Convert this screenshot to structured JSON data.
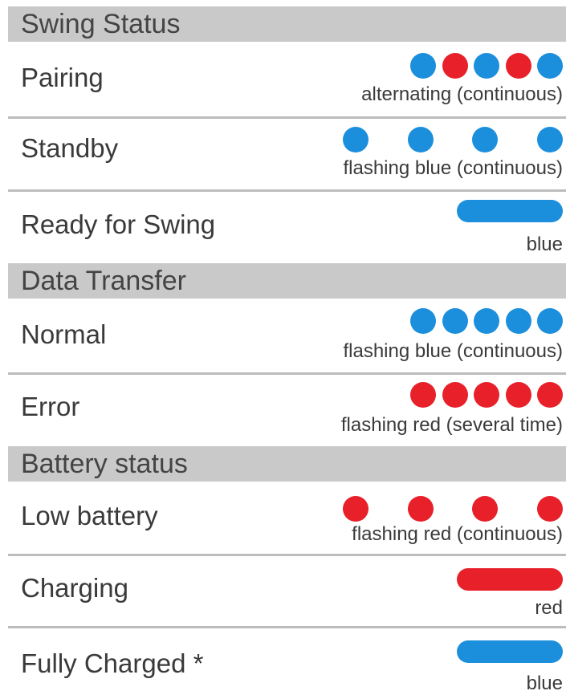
{
  "colors": {
    "blue": "#1c8fdc",
    "red": "#e8202a",
    "header_bg": "#c9c9c9",
    "divider": "#bdbdbd"
  },
  "sections": [
    {
      "title": "Swing Status",
      "rows": [
        {
          "label": "Pairing",
          "caption": "alternating (continuous)",
          "indicator": "dots",
          "pattern": [
            "blue",
            "red",
            "blue",
            "red",
            "blue"
          ],
          "spacing": "tight"
        },
        {
          "label": "Standby",
          "caption": "flashing blue (continuous)",
          "indicator": "dots",
          "pattern": [
            "blue",
            "blue",
            "blue",
            "blue"
          ],
          "spacing": "wide"
        },
        {
          "label": "Ready for Swing",
          "caption": "blue",
          "indicator": "bar",
          "pattern": [
            "blue"
          ]
        }
      ]
    },
    {
      "title": "Data Transfer",
      "rows": [
        {
          "label": "Normal",
          "caption": "flashing blue (continuous)",
          "indicator": "dots",
          "pattern": [
            "blue",
            "blue",
            "blue",
            "blue",
            "blue"
          ],
          "spacing": "tight"
        },
        {
          "label": "Error",
          "caption": "flashing red (several time)",
          "indicator": "dots",
          "pattern": [
            "red",
            "red",
            "red",
            "red",
            "red"
          ],
          "spacing": "tight"
        }
      ]
    },
    {
      "title": "Battery status",
      "rows": [
        {
          "label": "Low battery",
          "caption": "flashing red (continuous)",
          "indicator": "dots",
          "pattern": [
            "red",
            "red",
            "red",
            "red"
          ],
          "spacing": "wide"
        },
        {
          "label": "Charging",
          "caption": "red",
          "indicator": "bar",
          "pattern": [
            "red"
          ]
        },
        {
          "label": "Fully Charged *",
          "caption": "blue",
          "indicator": "bar",
          "pattern": [
            "blue"
          ]
        }
      ]
    }
  ]
}
